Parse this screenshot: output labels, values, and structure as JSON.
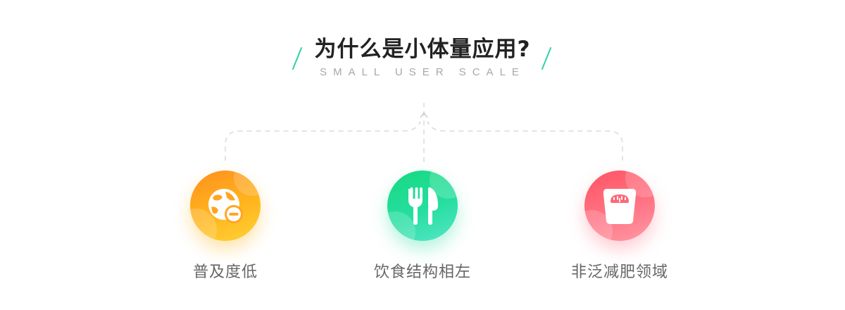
{
  "header": {
    "title": "为什么是小体量应用?",
    "subtitle": "SMALL USER SCALE"
  },
  "colors": {
    "accent": "#2fd2a4",
    "orange": "#ffaa22",
    "green": "#22dc96",
    "red": "#ff6676"
  },
  "features": [
    {
      "label": "普及度低",
      "icon": "globe-minus-icon"
    },
    {
      "label": "饮食结构相左",
      "icon": "fork-knife-icon"
    },
    {
      "label": "非泛减肥领域",
      "icon": "scale-icon"
    }
  ]
}
